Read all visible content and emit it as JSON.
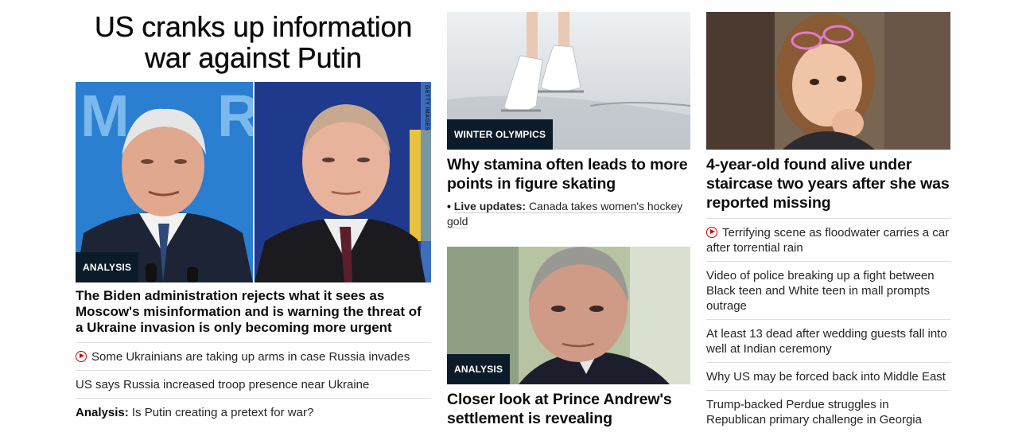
{
  "lead": {
    "headline": "US cranks up information war against Putin",
    "image_tag": "ANALYSIS",
    "image_credit": "GETTY IMAGES",
    "dek": "The Biden administration rejects what it sees as Moscow's misinformation and is warning the threat of a Ukraine invasion is only becoming more urgent",
    "related": [
      {
        "video": true,
        "prefix": "",
        "text": "Some Ukrainians are taking up arms in case Russia invades"
      },
      {
        "video": false,
        "prefix": "",
        "text": "US says Russia increased troop presence near Ukraine"
      },
      {
        "video": false,
        "prefix": "Analysis:",
        "text": "Is Putin creating a pretext for war?"
      }
    ]
  },
  "middle": {
    "card1": {
      "tag": "WINTER OLYMPICS",
      "headline": "Why stamina often leads to more points in figure skating",
      "live_prefix": "Live updates:",
      "live_text": "Canada takes women's hockey gold"
    },
    "card2": {
      "tag": "ANALYSIS",
      "headline": "Closer look at Prince Andrew's settlement is revealing"
    }
  },
  "right": {
    "card": {
      "headline": "4-year-old found alive under staircase two years after she was reported missing"
    },
    "list": [
      {
        "video": true,
        "text": "Terrifying scene as floodwater carries a car after torrential rain"
      },
      {
        "video": false,
        "text": "Video of police breaking up a fight between Black teen and White teen in mall prompts outrage"
      },
      {
        "video": false,
        "text": "At least 13 dead after wedding guests fall into well at Indian ceremony"
      },
      {
        "video": false,
        "text": "Why US may be forced back into Middle East"
      },
      {
        "video": false,
        "text": "Trump-backed Perdue struggles in Republican primary challenge in Georgia"
      }
    ]
  },
  "colors": {
    "tag_bg": "#0c1b2a",
    "video_red": "#cc0000",
    "divider": "#dedede"
  }
}
